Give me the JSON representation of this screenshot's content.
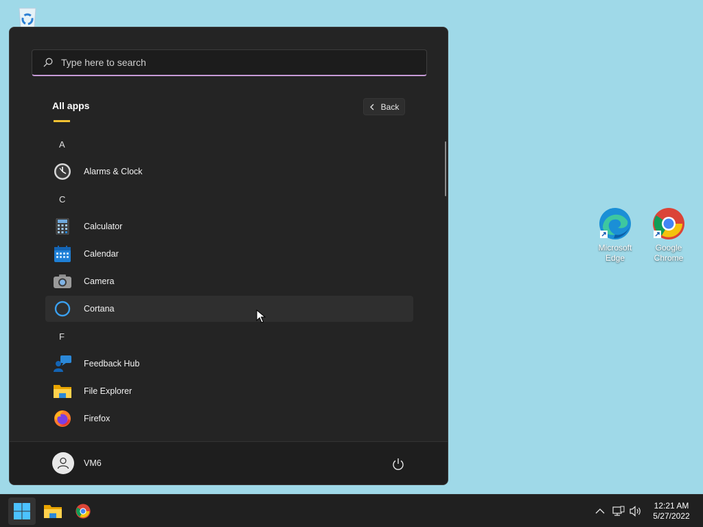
{
  "desktop": {
    "icons": [
      {
        "label": "Microsoft\nEdge",
        "icon": "edge-icon"
      },
      {
        "label": "Google\nChrome",
        "icon": "chrome-icon"
      }
    ],
    "recycle_bin_icon": "recycle-bin-icon"
  },
  "start_menu": {
    "search_placeholder": "Type here to search",
    "all_apps_title": "All apps",
    "back_label": "Back",
    "sections": [
      {
        "letter": "A",
        "apps": [
          {
            "name": "Alarms & Clock",
            "icon": "clock-icon"
          }
        ]
      },
      {
        "letter": "C",
        "apps": [
          {
            "name": "Calculator",
            "icon": "calculator-icon"
          },
          {
            "name": "Calendar",
            "icon": "calendar-icon"
          },
          {
            "name": "Camera",
            "icon": "camera-icon"
          },
          {
            "name": "Cortana",
            "icon": "cortana-icon"
          }
        ]
      },
      {
        "letter": "F",
        "apps": [
          {
            "name": "Feedback Hub",
            "icon": "feedback-hub-icon"
          },
          {
            "name": "File Explorer",
            "icon": "folder-icon"
          },
          {
            "name": "Firefox",
            "icon": "firefox-icon"
          }
        ]
      }
    ],
    "hovered_app": "Cortana",
    "user_name": "VM6"
  },
  "taskbar": {
    "pinned": [
      "start-icon",
      "file-explorer-icon",
      "chrome-icon"
    ],
    "clock_time": "12:21 AM",
    "clock_date": "5/27/2022"
  },
  "colors": {
    "desktop_bg": "#9fd9e8",
    "start_bg": "#242424",
    "accent": "#0078d4",
    "search_underline": "#c79bd8"
  }
}
